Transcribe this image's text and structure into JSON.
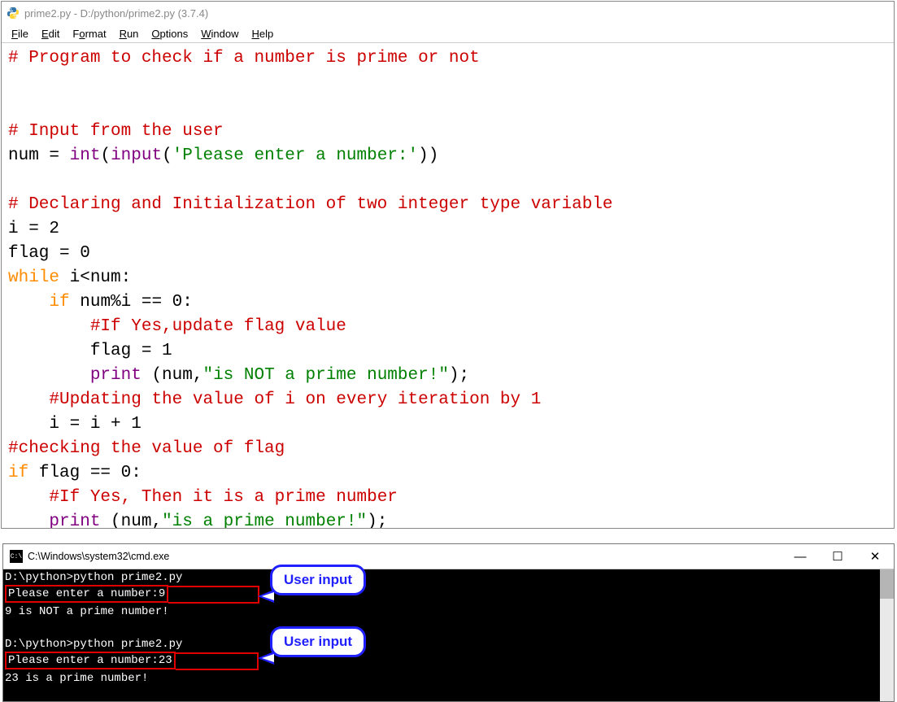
{
  "idle": {
    "title": "prime2.py - D:/python/prime2.py (3.7.4)",
    "menu": {
      "file": "File",
      "edit": "Edit",
      "format": "Format",
      "run": "Run",
      "options": "Options",
      "window": "Window",
      "help": "Help"
    },
    "code": {
      "c1": "# Program to check if a number is prime or not",
      "c2": "# Input from the user",
      "l3a": "num ",
      "l3op1": "=",
      "l3b": " ",
      "l3int": "int",
      "l3p1": "(",
      "l3input": "input",
      "l3p2": "(",
      "l3str": "'Please enter a number:'",
      "l3p3": "))",
      "c3": "# Declaring and Initialization of two integer type variable",
      "l4": "i = 2",
      "l5": "flag = 0",
      "l6kw": "while",
      "l6rest": " i<num:",
      "l7pad": "    ",
      "l7kw": "if",
      "l7rest": " num%i == 0:",
      "c4pad": "        ",
      "c4": "#If Yes,update flag value",
      "l8pad": "        ",
      "l8": "flag = 1",
      "l9pad": "        ",
      "l9print": "print",
      "l9mid": " (num,",
      "l9str": "\"is NOT a prime number!\"",
      "l9end": ");",
      "c5pad": "    ",
      "c5": "#Updating the value of i on every iteration by 1",
      "l10pad": "    ",
      "l10": "i = i + 1",
      "c6": "#checking the value of flag",
      "l11kw": "if",
      "l11rest": " flag == 0:",
      "c7pad": "    ",
      "c7": "#If Yes, Then it is a prime number",
      "l12pad": "    ",
      "l12print": "print",
      "l12mid": " (num,",
      "l12str": "\"is a prime number!\"",
      "l12end": ");"
    }
  },
  "cmd": {
    "title": "C:\\Windows\\system32\\cmd.exe",
    "icon_label": "C:\\",
    "lines": {
      "p1a": "D:\\python>",
      "p1b": "python prime2.py",
      "in1": "Please enter a number:9",
      "out1": "9 is NOT a prime number!",
      "p2a": "D:\\python>",
      "p2b": "python prime2.py",
      "in2": "Please enter a number:23",
      "out2": "23 is a prime number!"
    },
    "callouts": {
      "c1": "User input",
      "c2": "User input"
    },
    "win_btns": {
      "min": "—",
      "max": "☐",
      "close": "✕"
    }
  }
}
